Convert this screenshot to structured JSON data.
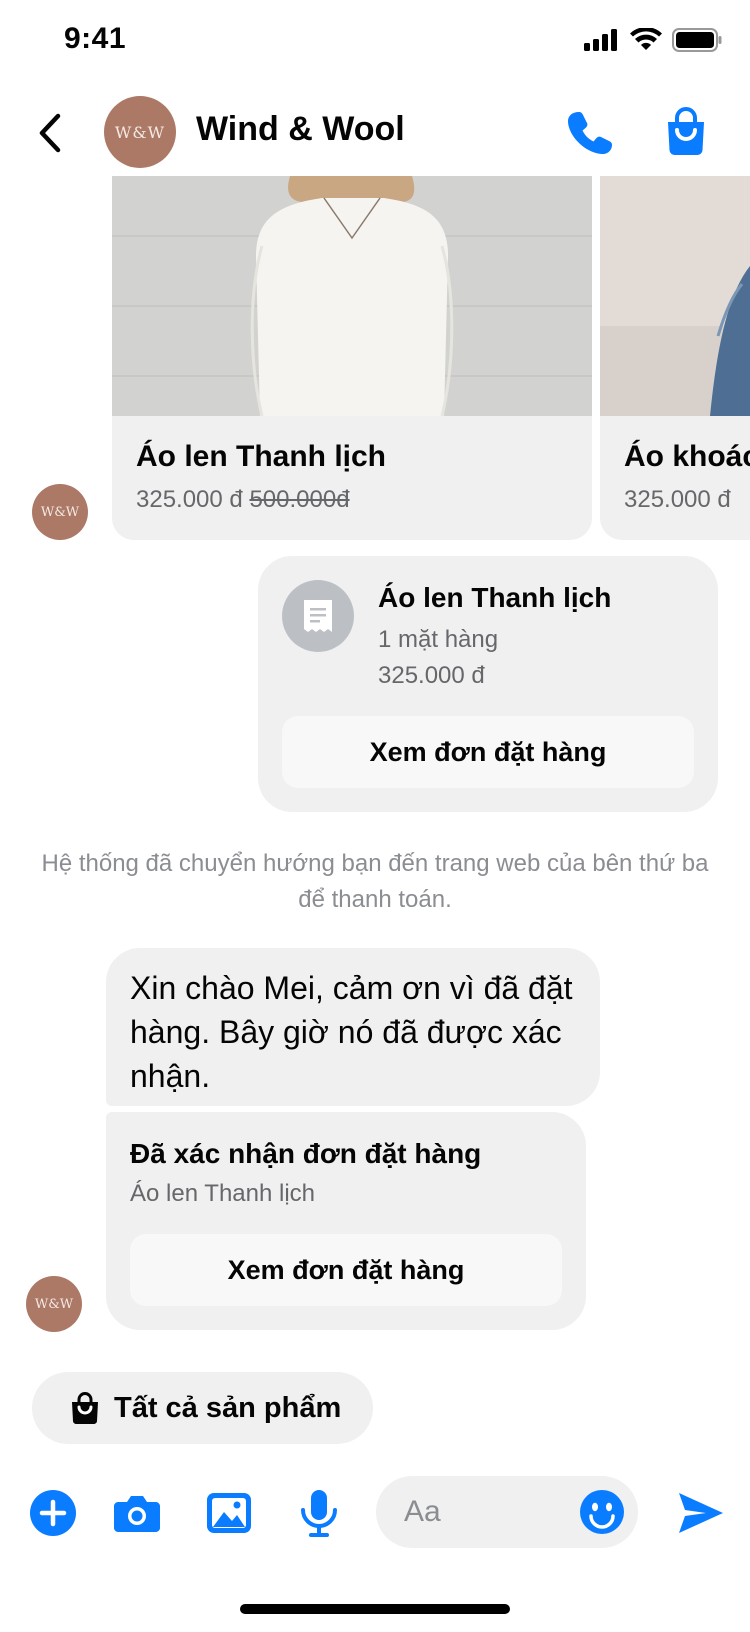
{
  "status_bar": {
    "time": "9:41"
  },
  "header": {
    "title": "Wind & Wool",
    "avatar_text": "W&W"
  },
  "products": [
    {
      "name": "Áo len Thanh lịch",
      "price": "325.000 đ",
      "old_price": "500.000đ"
    },
    {
      "name": "Áo khoác",
      "price": "325.000 đ"
    }
  ],
  "receipt": {
    "title": "Áo len Thanh lịch",
    "quantity": "1 mặt hàng",
    "price": "325.000 đ",
    "button": "Xem đơn đặt hàng"
  },
  "system_note": "Hệ thống đã chuyển hướng bạn đến trang web của bên thứ ba để thanh toán.",
  "message": "Xin chào Mei, cảm ơn vì đã đặt hàng. Bây giờ nó đã được xác nhận.",
  "confirmation": {
    "title": "Đã xác nhận đơn đặt hàng",
    "subtitle": "Áo len Thanh lịch",
    "button": "Xem đơn đặt hàng"
  },
  "quick_reply": "Tất cả sản phẩm",
  "composer": {
    "placeholder": "Aa"
  },
  "colors": {
    "accent": "#0a7cff",
    "bubble": "#f0f0f0",
    "avatar": "#ad7967"
  }
}
